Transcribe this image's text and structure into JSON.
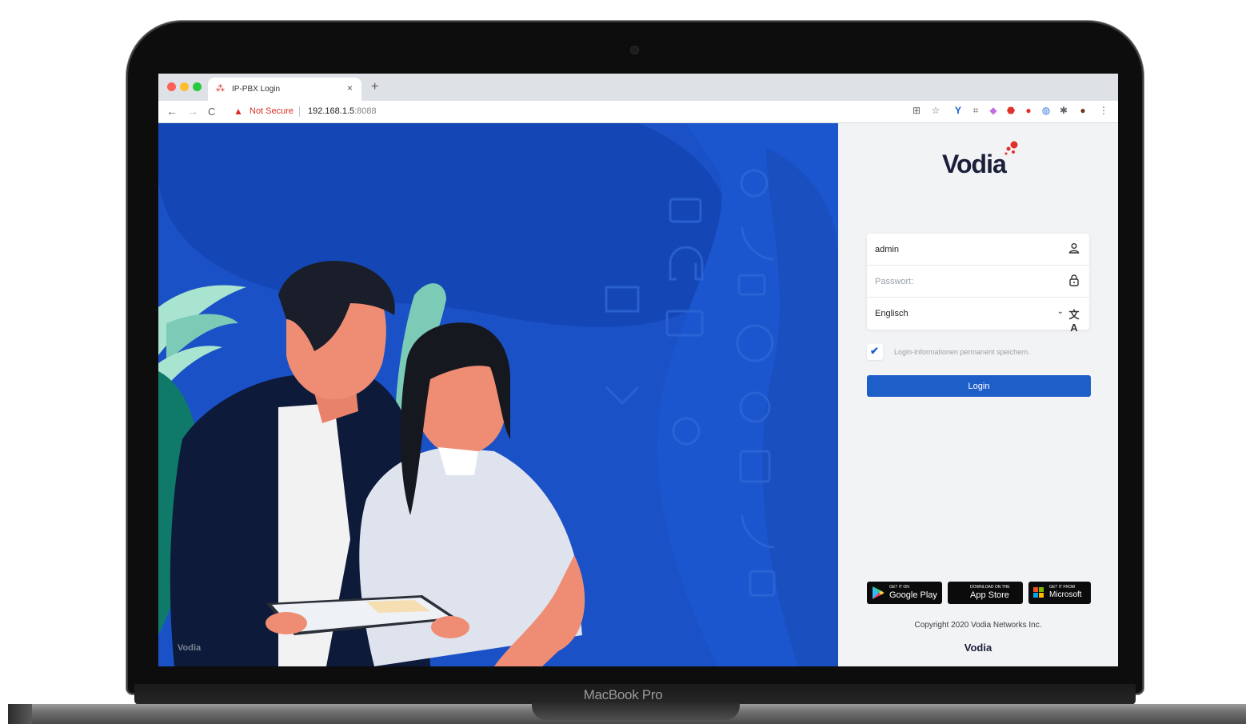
{
  "device": {
    "model_label": "MacBook Pro"
  },
  "browser": {
    "tab": {
      "title": "IP-PBX Login",
      "close_label": "×",
      "new_tab_label": "+"
    },
    "nav": {
      "back": "←",
      "forward": "→",
      "reload": "C"
    },
    "address": {
      "security_label": "Not Secure",
      "host": "192.168.1.5",
      "port": ":8088"
    },
    "extensions": [
      "translate-icon",
      "star-icon",
      "vodia-ext-icon",
      "screenshot-icon",
      "pen-icon",
      "adblock-icon",
      "circle-ext-icon",
      "blue-ext-icon",
      "puzzle-icon",
      "profile-icon",
      "menu-icon"
    ]
  },
  "hero": {
    "watermark": "Vodia"
  },
  "login": {
    "brand": "Vodia",
    "username": {
      "value": "admin",
      "icon": "user-icon"
    },
    "password": {
      "placeholder": "Passwort:",
      "icon": "lock-icon"
    },
    "language": {
      "value": "Englisch",
      "icon": "translate-icon"
    },
    "remember": {
      "checked": true,
      "label": "Login-Informationen permanent speichern."
    },
    "submit_label": "Login",
    "stores": [
      {
        "small": "GET IT ON",
        "big": "Google Play",
        "icon": "google-play-icon"
      },
      {
        "small": "Download on the",
        "big": "App Store",
        "icon": "apple-icon"
      },
      {
        "small": "Get it from",
        "big": "Microsoft",
        "icon": "microsoft-icon"
      }
    ],
    "copyright": "Copyright 2020 Vodia Networks Inc.",
    "footer_brand": "Vodia"
  },
  "colors": {
    "primary": "#1d5ec9",
    "hero_bg": "#1a51c6",
    "panel_bg": "#f2f3f5",
    "brand_dot": "#e0312b"
  }
}
